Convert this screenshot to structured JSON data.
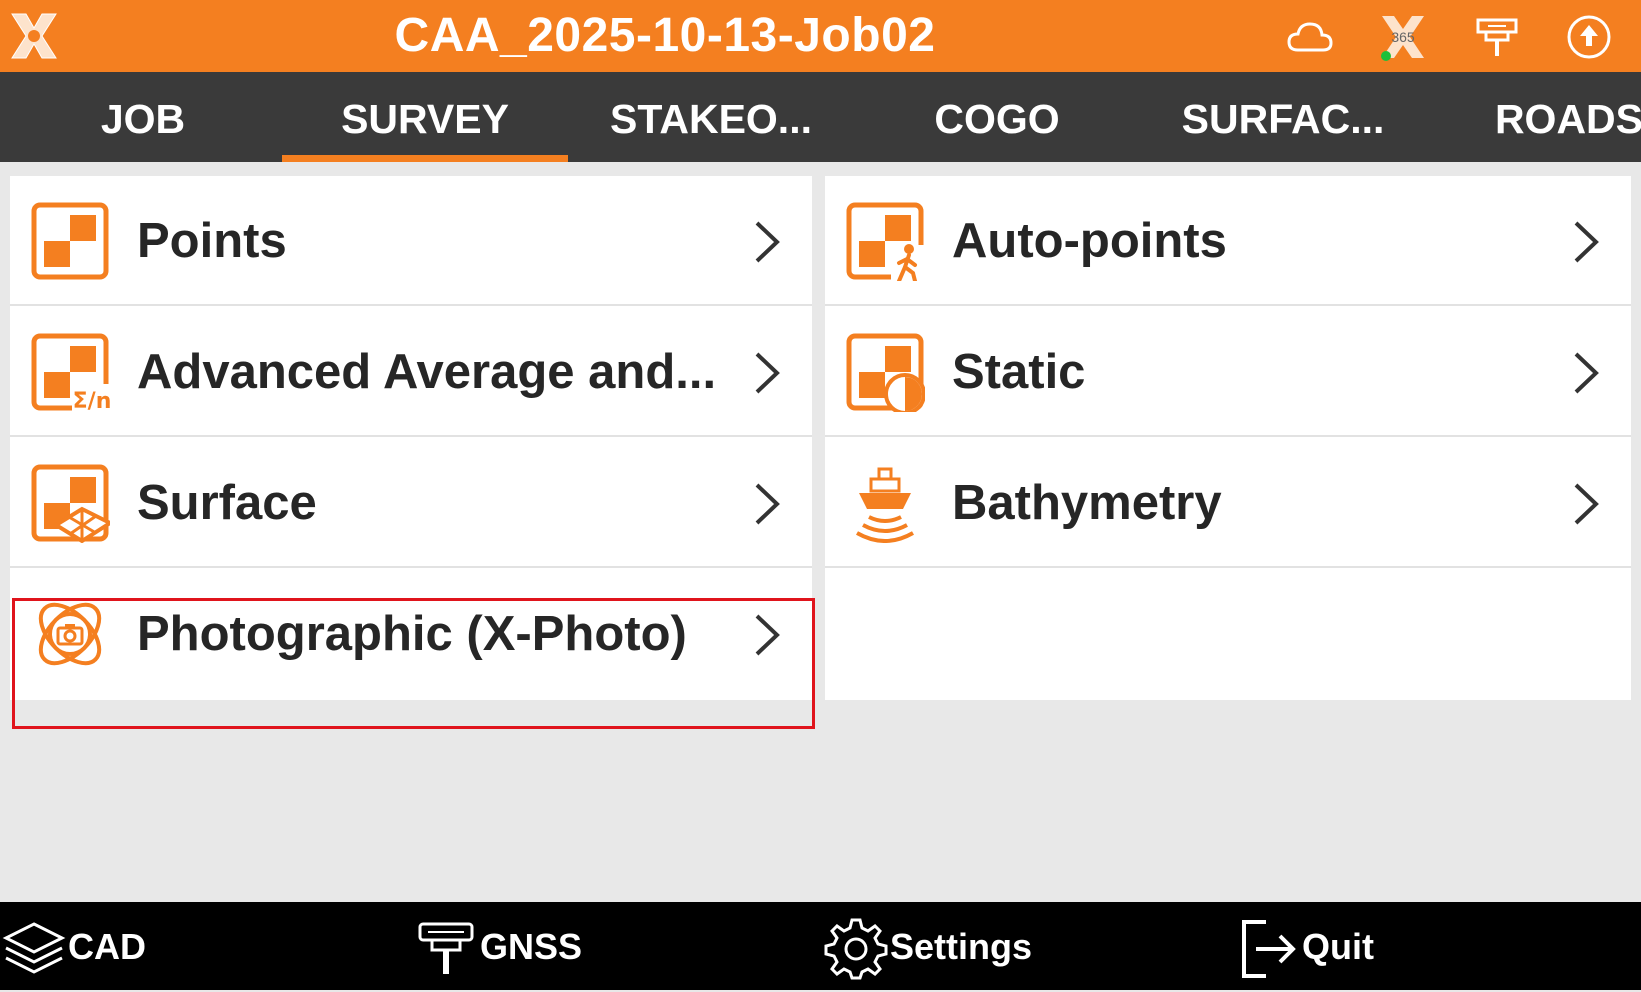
{
  "titlebar": {
    "title": "CAA_2025-10-13-Job02",
    "icons": [
      "app-logo-icon",
      "cloud-icon",
      "x365-icon",
      "gnss-receiver-icon",
      "upload-icon"
    ],
    "x365_badge": "365",
    "accent_color": "#f47f20"
  },
  "tabs": [
    {
      "label": "JOB"
    },
    {
      "label": "SURVEY"
    },
    {
      "label": "STAKEO..."
    },
    {
      "label": "COGO"
    },
    {
      "label": "SURFAC..."
    },
    {
      "label": "ROADS"
    }
  ],
  "active_tab": "SURVEY",
  "menu": {
    "left": [
      {
        "label": "Points",
        "icon": "points-icon"
      },
      {
        "label": "Advanced Average and...",
        "icon": "average-points-icon",
        "icon_text": "Σ/n"
      },
      {
        "label": "Surface",
        "icon": "surface-icon"
      },
      {
        "label": "Photographic (X-Photo)",
        "icon": "camera-icon"
      }
    ],
    "right": [
      {
        "label": "Auto-points",
        "icon": "auto-points-icon"
      },
      {
        "label": "Static",
        "icon": "static-icon"
      },
      {
        "label": "Bathymetry",
        "icon": "boat-icon"
      }
    ],
    "highlighted_item": "Surface",
    "highlight_color": "#e0141c"
  },
  "bottombar": {
    "cad": "CAD",
    "gnss": "GNSS",
    "settings": "Settings",
    "quit": "Quit"
  }
}
